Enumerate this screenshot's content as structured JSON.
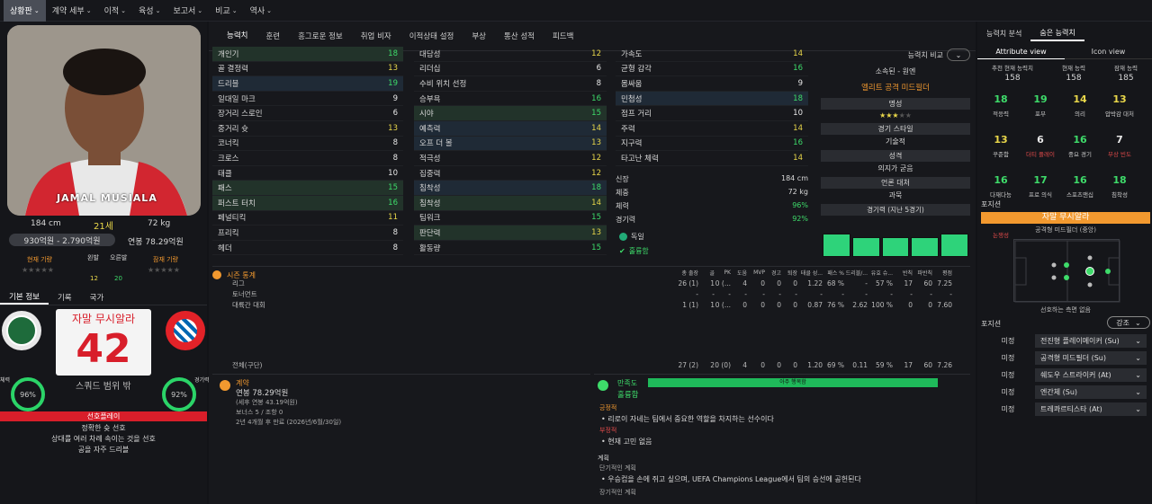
{
  "menu": [
    {
      "label": "상황판",
      "active": true
    },
    {
      "label": "계약 세부",
      "active": false
    },
    {
      "label": "이적",
      "active": false
    },
    {
      "label": "육성",
      "active": false
    },
    {
      "label": "보고서",
      "active": false
    },
    {
      "label": "비교",
      "active": false
    },
    {
      "label": "역사",
      "active": false
    }
  ],
  "player": {
    "name_on_photo": "JAMAL MUSIALA",
    "height": "184 cm",
    "age": "21세",
    "weight": "72 kg",
    "value_range": "930억원 - 2.790억원",
    "salary": "연봉 78.29억원",
    "current_potential_label": "현재 기량",
    "potential_label": "잠재 기량",
    "left_foot_label": "왼발",
    "right_foot_label": "오른발",
    "left_foot_val": "12",
    "right_foot_val": "20"
  },
  "left_tabs": [
    "기본 정보",
    "기록",
    "국가"
  ],
  "jersey": {
    "name": "자말 무시알라",
    "number": "42",
    "caption": "스쿼드 범위 밖"
  },
  "gauges": {
    "left": {
      "label": "체력",
      "value": "96%"
    },
    "right": {
      "label": "경기력",
      "value": "92%"
    }
  },
  "playstyle": {
    "title": "선호플레이",
    "items": [
      "정확한 슛 선호",
      "상대를 여러 차례 속이는 것을 선호",
      "공을 자주 드리블"
    ]
  },
  "mid_tabs": [
    "능력치",
    "훈련",
    "흥그로운 정보",
    "취업 비자",
    "이적상태 설정",
    "부상",
    "통산 성적",
    "피드백"
  ],
  "attr_col1": [
    {
      "name": "개인기",
      "val": "18",
      "c": "g",
      "hl": "g"
    },
    {
      "name": "골 결정력",
      "val": "13",
      "c": "y",
      "hl": ""
    },
    {
      "name": "드리블",
      "val": "19",
      "c": "g",
      "hl": "b"
    },
    {
      "name": "일대일 마크",
      "val": "9",
      "c": "w",
      "hl": ""
    },
    {
      "name": "장거리 스로인",
      "val": "6",
      "c": "w",
      "hl": ""
    },
    {
      "name": "중거리 슛",
      "val": "13",
      "c": "y",
      "hl": ""
    },
    {
      "name": "코너킥",
      "val": "8",
      "c": "w",
      "hl": ""
    },
    {
      "name": "크로스",
      "val": "8",
      "c": "w",
      "hl": ""
    },
    {
      "name": "태클",
      "val": "10",
      "c": "w",
      "hl": ""
    },
    {
      "name": "패스",
      "val": "15",
      "c": "g",
      "hl": "g"
    },
    {
      "name": "퍼스트 터치",
      "val": "16",
      "c": "g",
      "hl": "g"
    },
    {
      "name": "페널티킥",
      "val": "11",
      "c": "y",
      "hl": ""
    },
    {
      "name": "프리킥",
      "val": "8",
      "c": "w",
      "hl": ""
    },
    {
      "name": "헤더",
      "val": "8",
      "c": "w",
      "hl": ""
    }
  ],
  "attr_col2": [
    {
      "name": "대담성",
      "val": "12",
      "c": "y",
      "hl": ""
    },
    {
      "name": "리더십",
      "val": "6",
      "c": "w",
      "hl": ""
    },
    {
      "name": "수비 위치 선정",
      "val": "8",
      "c": "w",
      "hl": ""
    },
    {
      "name": "승부욕",
      "val": "16",
      "c": "g",
      "hl": ""
    },
    {
      "name": "시야",
      "val": "15",
      "c": "g",
      "hl": "g"
    },
    {
      "name": "예측력",
      "val": "14",
      "c": "y",
      "hl": "b"
    },
    {
      "name": "오프 더 볼",
      "val": "13",
      "c": "y",
      "hl": "b"
    },
    {
      "name": "적극성",
      "val": "12",
      "c": "y",
      "hl": ""
    },
    {
      "name": "집중력",
      "val": "12",
      "c": "y",
      "hl": ""
    },
    {
      "name": "침착성",
      "val": "18",
      "c": "g",
      "hl": "b"
    },
    {
      "name": "침착성",
      "val": "14",
      "c": "y",
      "hl": "g"
    },
    {
      "name": "팀워크",
      "val": "15",
      "c": "g",
      "hl": ""
    },
    {
      "name": "판단력",
      "val": "13",
      "c": "y",
      "hl": "g"
    },
    {
      "name": "활동량",
      "val": "15",
      "c": "g",
      "hl": ""
    }
  ],
  "attr_col3": [
    {
      "name": "가속도",
      "val": "14",
      "c": "y",
      "hl": ""
    },
    {
      "name": "균형 감각",
      "val": "16",
      "c": "g",
      "hl": ""
    },
    {
      "name": "몸싸움",
      "val": "9",
      "c": "w",
      "hl": ""
    },
    {
      "name": "민첩성",
      "val": "18",
      "c": "g",
      "hl": "b"
    },
    {
      "name": "점프 거리",
      "val": "10",
      "c": "w",
      "hl": ""
    },
    {
      "name": "주력",
      "val": "14",
      "c": "y",
      "hl": ""
    },
    {
      "name": "지구력",
      "val": "16",
      "c": "g",
      "hl": ""
    },
    {
      "name": "타고난 체력",
      "val": "14",
      "c": "y",
      "hl": ""
    }
  ],
  "phys": [
    {
      "k": "신장",
      "v": "184 cm"
    },
    {
      "k": "체중",
      "v": "72 kg"
    },
    {
      "k": "체력",
      "v": "96%"
    },
    {
      "k": "경기력",
      "v": "92%"
    }
  ],
  "nation": "독일",
  "happy": "훌륭함",
  "compare": {
    "btn": "능력치 비교",
    "club_label": "소속된 - 원엔",
    "role": "엘리트 공격 미드필더",
    "rep_label": "명성",
    "style_label": "경기 스타일",
    "style": "기술적",
    "personality_label": "성격",
    "personality": "의지가 굳음",
    "media_label": "언론 대처",
    "media": "과묵",
    "form_label": "경기력 (지난 5경기)"
  },
  "season": {
    "title": "시즌 통계",
    "headers": [
      "총 출장",
      "골",
      "PK",
      "도움",
      "MVP",
      "경고",
      "퇴장",
      "태클 성...",
      "패스 %",
      "드리블/...",
      "유효 슈...",
      "반칙",
      "파반칙",
      "평점"
    ],
    "rows": [
      {
        "name": "리그",
        "vals": [
          "26 (1)",
          "1",
          "0 (...",
          "4",
          "0",
          "0",
          "0",
          "1.22",
          "68 %",
          "-",
          "57 %",
          "17",
          "60",
          "7.25"
        ]
      },
      {
        "name": "토너먼트",
        "vals": [
          "-",
          "-",
          "-",
          "-",
          "-",
          "-",
          "-",
          "-",
          "-",
          "-",
          "-",
          "-",
          "-",
          "-"
        ]
      },
      {
        "name": "대륙간 대회",
        "vals": [
          "1 (1)",
          "1",
          "0 (...",
          "0",
          "0",
          "0",
          "0",
          "0.87",
          "76 %",
          "2.62",
          "100 %",
          "0",
          "0",
          "7.60"
        ]
      }
    ],
    "total_name": "전체(구단)",
    "total": [
      "27 (2)",
      "2",
      "0 (0)",
      "4",
      "0",
      "0",
      "0",
      "1.20",
      "69 %",
      "0.11",
      "59 %",
      "17",
      "60",
      "7.26"
    ]
  },
  "contract": {
    "title": "계약",
    "salary": "연봉 78.29억원",
    "tax": "(세후 연봉 43.19억원)",
    "bonus": "보너스 5 / 조항 0",
    "end": "2년 4개월 후 만료 (2026년/6월/30일)"
  },
  "satisfaction": {
    "title": "만족도",
    "value": "훌륭함",
    "bar": "아주 행복함",
    "pos_label": "긍정적",
    "pos": "리로이 자네는 팀에서 중요한 역할을 차지하는 선수이다",
    "neg_label": "부정적",
    "neg": "현재 고민 없음",
    "plan_label": "계획",
    "short_label": "단기적인 계획",
    "short": "우승컵을 손에 쥐고 싶으며, UEFA Champions League에서 팀의 승선에 공헌된다",
    "long_label": "장기적인 계획"
  },
  "right_tabs": [
    "능력치 분석",
    "숨은 능력치"
  ],
  "view_tabs": [
    "Attribute view",
    "Icon view"
  ],
  "ratings": [
    {
      "label": "추천 현재 능력치",
      "val": "158"
    },
    {
      "label": "현재 능력",
      "val": "158"
    },
    {
      "label": "잠재 능력",
      "val": "185"
    }
  ],
  "hidden": [
    {
      "n": "18",
      "l": "적응력",
      "c": "#3edb6a"
    },
    {
      "n": "19",
      "l": "포부",
      "c": "#3edb6a"
    },
    {
      "n": "14",
      "l": "의리",
      "c": "#e9d74a"
    },
    {
      "n": "13",
      "l": "압박감 대처",
      "c": "#e9d74a"
    },
    {
      "n": "13",
      "l": "꾸준함",
      "c": "#e9d74a"
    },
    {
      "n": "6",
      "l": "더티 플레이",
      "c": "#e8e8e8"
    },
    {
      "n": "16",
      "l": "중요 경기",
      "c": "#3edb6a"
    },
    {
      "n": "7",
      "l": "부상 빈도",
      "c": "#e8e8e8"
    },
    {
      "n": "16",
      "l": "다재다능",
      "c": "#3edb6a"
    },
    {
      "n": "17",
      "l": "프로 의식",
      "c": "#3edb6a"
    },
    {
      "n": "16",
      "l": "스포츠맨십",
      "c": "#3edb6a"
    },
    {
      "n": "18",
      "l": "침착성",
      "c": "#3edb6a"
    },
    {
      "n": "4",
      "l": "논쟁성",
      "c": "#e8e8e8"
    }
  ],
  "position": {
    "title": "포지션",
    "main": "자말 무시알라",
    "sub": "공격형 미드필더 (중앙)",
    "caption": "선호하는 측면 없음"
  },
  "roles": {
    "title": "포지션",
    "btn": "강조",
    "items": [
      {
        "k": "미정",
        "v": "전진형 플레이메이커 (Su)"
      },
      {
        "k": "미정",
        "v": "공격형 미드필더 (Su)"
      },
      {
        "k": "미정",
        "v": "쉐도우 스트라이커 (At)"
      },
      {
        "k": "미정",
        "v": "엔간체 (Su)"
      },
      {
        "k": "미정",
        "v": "트레콰르티스타 (At)"
      }
    ]
  },
  "colors": {
    "accent_orange": "#f2992f",
    "green": "#3edb6a",
    "yellow": "#e9d74a",
    "red_banner": "#d81e2a"
  }
}
